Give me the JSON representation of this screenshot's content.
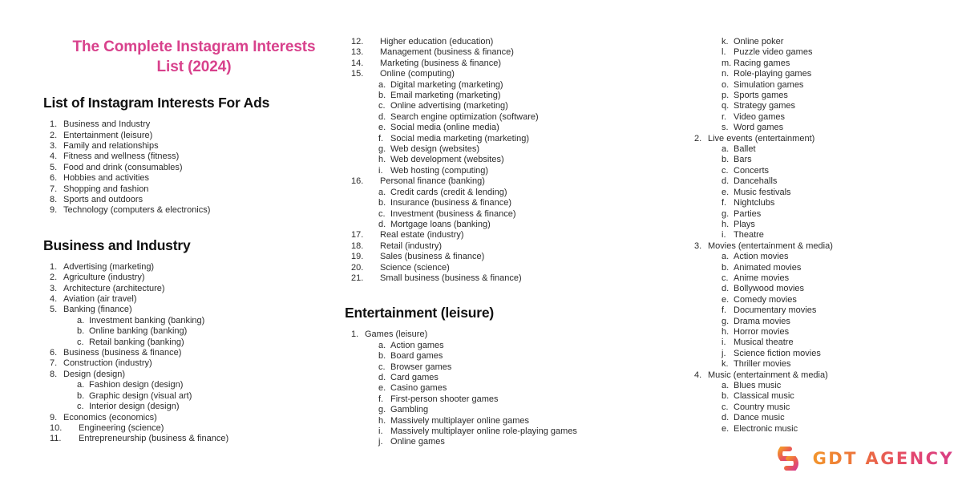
{
  "document": {
    "title": "The Complete Instagram Interests List (2024)",
    "title_color": "#d8418c"
  },
  "columns": [
    {
      "id": "column-1",
      "blocks": [
        {
          "type": "heading",
          "text": "List of Instagram Interests For Ads"
        },
        {
          "type": "list",
          "items": [
            {
              "level": 1,
              "marker": "1.",
              "text": "Business and Industry"
            },
            {
              "level": 1,
              "marker": "2.",
              "text": "Entertainment (leisure)"
            },
            {
              "level": 1,
              "marker": "3.",
              "text": "Family and relationships"
            },
            {
              "level": 1,
              "marker": "4.",
              "text": "Fitness and wellness (fitness)"
            },
            {
              "level": 1,
              "marker": "5.",
              "text": "Food and drink (consumables)"
            },
            {
              "level": 1,
              "marker": "6.",
              "text": "Hobbies and activities"
            },
            {
              "level": 1,
              "marker": "7.",
              "text": "Shopping and fashion"
            },
            {
              "level": 1,
              "marker": "8.",
              "text": "Sports and outdoors"
            },
            {
              "level": 1,
              "marker": "9.",
              "text": "Technology (computers & electronics)"
            }
          ]
        },
        {
          "type": "heading",
          "text": "Business and Industry",
          "gap_above": true
        },
        {
          "type": "list",
          "items": [
            {
              "level": 1,
              "marker": "1.",
              "text": "Advertising (marketing)"
            },
            {
              "level": 1,
              "marker": "2.",
              "text": "Agriculture (industry)"
            },
            {
              "level": 1,
              "marker": "3.",
              "text": "Architecture (architecture)"
            },
            {
              "level": 1,
              "marker": "4.",
              "text": "Aviation (air travel)"
            },
            {
              "level": 1,
              "marker": "5.",
              "text": "Banking (finance)"
            },
            {
              "level": 2,
              "marker": "a.",
              "text": "Investment banking (banking)"
            },
            {
              "level": 2,
              "marker": "b.",
              "text": "Online banking (banking)"
            },
            {
              "level": 2,
              "marker": "c.",
              "text": "Retail banking (banking)"
            },
            {
              "level": 1,
              "marker": "6.",
              "text": "Business (business & finance)"
            },
            {
              "level": 1,
              "marker": "7.",
              "text": "Construction (industry)"
            },
            {
              "level": 1,
              "marker": "8.",
              "text": "Design (design)"
            },
            {
              "level": 2,
              "marker": "a.",
              "text": "Fashion design (design)"
            },
            {
              "level": 2,
              "marker": "b.",
              "text": "Graphic design (visual art)"
            },
            {
              "level": 2,
              "marker": "c.",
              "text": "Interior design (design)"
            },
            {
              "level": 1,
              "marker": "9.",
              "text": "Economics (economics)"
            },
            {
              "level": 1,
              "marker": "10.",
              "text": "Engineering (science)",
              "wide": true
            },
            {
              "level": 1,
              "marker": "11.",
              "text": "Entrepreneurship (business & finance)",
              "wide": true
            }
          ]
        }
      ]
    },
    {
      "id": "column-2",
      "blocks": [
        {
          "type": "list",
          "items": [
            {
              "level": 1,
              "marker": "12.",
              "text": "Higher education (education)",
              "wide": true
            },
            {
              "level": 1,
              "marker": "13.",
              "text": "Management (business & finance)",
              "wide": true
            },
            {
              "level": 1,
              "marker": "14.",
              "text": "Marketing (business & finance)",
              "wide": true
            },
            {
              "level": 1,
              "marker": "15.",
              "text": "Online (computing)",
              "wide": true
            },
            {
              "level": 2,
              "marker": "a.",
              "text": "Digital marketing (marketing)"
            },
            {
              "level": 2,
              "marker": "b.",
              "text": "Email marketing (marketing)"
            },
            {
              "level": 2,
              "marker": "c.",
              "text": "Online advertising (marketing)"
            },
            {
              "level": 2,
              "marker": "d.",
              "text": "Search engine optimization (software)"
            },
            {
              "level": 2,
              "marker": "e.",
              "text": "Social media (online media)"
            },
            {
              "level": 2,
              "marker": "f.",
              "text": "Social media marketing (marketing)"
            },
            {
              "level": 2,
              "marker": "g.",
              "text": "Web design (websites)"
            },
            {
              "level": 2,
              "marker": "h.",
              "text": "Web development (websites)"
            },
            {
              "level": 2,
              "marker": "i.",
              "text": "Web hosting (computing)"
            },
            {
              "level": 1,
              "marker": "16.",
              "text": "Personal finance (banking)",
              "wide": true
            },
            {
              "level": 2,
              "marker": "a.",
              "text": "Credit cards (credit & lending)"
            },
            {
              "level": 2,
              "marker": "b.",
              "text": "Insurance (business & finance)"
            },
            {
              "level": 2,
              "marker": "c.",
              "text": "Investment (business & finance)"
            },
            {
              "level": 2,
              "marker": "d.",
              "text": "Mortgage loans (banking)"
            },
            {
              "level": 1,
              "marker": "17.",
              "text": "Real estate (industry)",
              "wide": true
            },
            {
              "level": 1,
              "marker": "18.",
              "text": "Retail (industry)",
              "wide": true
            },
            {
              "level": 1,
              "marker": "19.",
              "text": "Sales (business & finance)",
              "wide": true
            },
            {
              "level": 1,
              "marker": "20.",
              "text": "Science (science)",
              "wide": true
            },
            {
              "level": 1,
              "marker": "21.",
              "text": "Small business (business & finance)",
              "wide": true
            }
          ]
        },
        {
          "type": "heading",
          "text": "Entertainment (leisure)",
          "gap_above": true
        },
        {
          "type": "list",
          "items": [
            {
              "level": 1,
              "marker": "1.",
              "text": "Games (leisure)"
            },
            {
              "level": 2,
              "marker": "a.",
              "text": "Action games"
            },
            {
              "level": 2,
              "marker": "b.",
              "text": "Board games"
            },
            {
              "level": 2,
              "marker": "c.",
              "text": "Browser games"
            },
            {
              "level": 2,
              "marker": "d.",
              "text": "Card games"
            },
            {
              "level": 2,
              "marker": "e.",
              "text": "Casino games"
            },
            {
              "level": 2,
              "marker": "f.",
              "text": "First-person shooter games"
            },
            {
              "level": 2,
              "marker": "g.",
              "text": "Gambling"
            },
            {
              "level": 2,
              "marker": "h.",
              "text": "Massively multiplayer online games"
            },
            {
              "level": 2,
              "marker": "i.",
              "text": "Massively multiplayer online role-playing games"
            },
            {
              "level": 2,
              "marker": "j.",
              "text": "Online games"
            }
          ]
        }
      ]
    },
    {
      "id": "column-3",
      "blocks": [
        {
          "type": "list",
          "items": [
            {
              "level": 2,
              "marker": "k.",
              "text": "Online poker"
            },
            {
              "level": 2,
              "marker": "l.",
              "text": "Puzzle video games"
            },
            {
              "level": 2,
              "marker": "m.",
              "text": "Racing games"
            },
            {
              "level": 2,
              "marker": "n.",
              "text": "Role-playing games"
            },
            {
              "level": 2,
              "marker": "o.",
              "text": "Simulation games"
            },
            {
              "level": 2,
              "marker": "p.",
              "text": "Sports games"
            },
            {
              "level": 2,
              "marker": "q.",
              "text": "Strategy games"
            },
            {
              "level": 2,
              "marker": "r.",
              "text": "Video games"
            },
            {
              "level": 2,
              "marker": "s.",
              "text": "Word games"
            },
            {
              "level": 1,
              "marker": "2.",
              "text": "Live events (entertainment)"
            },
            {
              "level": 2,
              "marker": "a.",
              "text": "Ballet"
            },
            {
              "level": 2,
              "marker": "b.",
              "text": "Bars"
            },
            {
              "level": 2,
              "marker": "c.",
              "text": "Concerts"
            },
            {
              "level": 2,
              "marker": "d.",
              "text": "Dancehalls"
            },
            {
              "level": 2,
              "marker": "e.",
              "text": "Music festivals"
            },
            {
              "level": 2,
              "marker": "f.",
              "text": "Nightclubs"
            },
            {
              "level": 2,
              "marker": "g.",
              "text": "Parties"
            },
            {
              "level": 2,
              "marker": "h.",
              "text": "Plays"
            },
            {
              "level": 2,
              "marker": "i.",
              "text": "Theatre"
            },
            {
              "level": 1,
              "marker": "3.",
              "text": "Movies (entertainment & media)"
            },
            {
              "level": 2,
              "marker": "a.",
              "text": "Action movies"
            },
            {
              "level": 2,
              "marker": "b.",
              "text": "Animated movies"
            },
            {
              "level": 2,
              "marker": "c.",
              "text": "Anime movies"
            },
            {
              "level": 2,
              "marker": "d.",
              "text": "Bollywood movies"
            },
            {
              "level": 2,
              "marker": "e.",
              "text": "Comedy movies"
            },
            {
              "level": 2,
              "marker": "f.",
              "text": "Documentary movies"
            },
            {
              "level": 2,
              "marker": "g.",
              "text": "Drama movies"
            },
            {
              "level": 2,
              "marker": "h.",
              "text": "Horror movies"
            },
            {
              "level": 2,
              "marker": "i.",
              "text": "Musical theatre"
            },
            {
              "level": 2,
              "marker": "j.",
              "text": "Science fiction movies"
            },
            {
              "level": 2,
              "marker": "k.",
              "text": "Thriller movies"
            },
            {
              "level": 1,
              "marker": "4.",
              "text": "Music (entertainment & media)"
            },
            {
              "level": 2,
              "marker": "a.",
              "text": "Blues music"
            },
            {
              "level": 2,
              "marker": "b.",
              "text": "Classical music"
            },
            {
              "level": 2,
              "marker": "c.",
              "text": "Country music"
            },
            {
              "level": 2,
              "marker": "d.",
              "text": "Dance music"
            },
            {
              "level": 2,
              "marker": "e.",
              "text": "Electronic music"
            }
          ]
        }
      ]
    }
  ],
  "logo": {
    "text": "GDT AGENCY",
    "monogram": "GD",
    "gradient_from": "#f2952c",
    "gradient_to": "#d83f86"
  }
}
